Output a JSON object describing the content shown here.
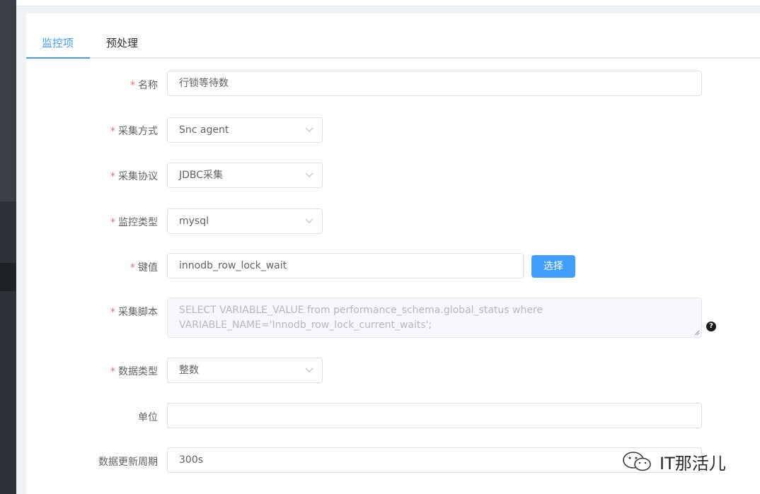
{
  "tabs": [
    {
      "label": "监控项",
      "active": true
    },
    {
      "label": "预处理",
      "active": false
    }
  ],
  "form": {
    "required_mark": "*",
    "name": {
      "label": "名称",
      "value": "行锁等待数"
    },
    "collect_method": {
      "label": "采集方式",
      "value": "Snc agent"
    },
    "collect_protocol": {
      "label": "采集协议",
      "value": "JDBC采集"
    },
    "monitor_type": {
      "label": "监控类型",
      "value": "mysql"
    },
    "key": {
      "label": "键值",
      "value": "innodb_row_lock_wait",
      "button": "选择"
    },
    "script": {
      "label": "采集脚本",
      "value": "SELECT VARIABLE_VALUE from performance_schema.global_status where VARIABLE_NAME='Innodb_row_lock_current_waits';",
      "help": "?"
    },
    "data_type": {
      "label": "数据类型",
      "value": "整数"
    },
    "unit": {
      "label": "单位",
      "value": ""
    },
    "update_interval": {
      "label": "数据更新周期",
      "value": "300s"
    }
  },
  "watermark": {
    "text": "IT那活儿",
    "icon": "wechat-icon"
  },
  "colors": {
    "accent": "#409eff",
    "required": "#f56c6c",
    "sidebar": "#2d3238"
  }
}
